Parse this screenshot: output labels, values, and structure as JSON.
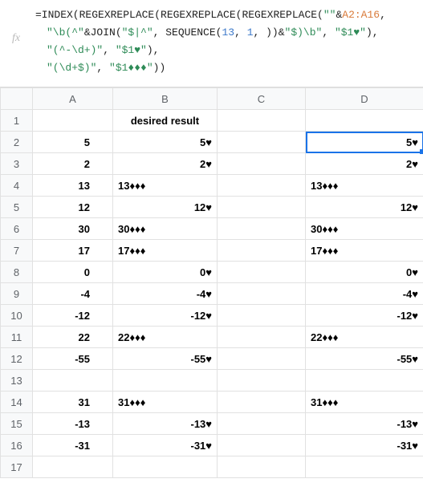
{
  "formula": {
    "parts_line1": [
      {
        "t": "=INDEX(REGEXREPLACE(REGEXREPLACE(REGEXREPLACE(",
        "c": "t-plain"
      },
      {
        "t": "\"\"",
        "c": "t-green"
      },
      {
        "t": "&",
        "c": "t-plain"
      },
      {
        "t": "A2:A16",
        "c": "t-orange"
      },
      {
        "t": ",",
        "c": "t-plain"
      }
    ],
    "parts_line2": [
      {
        "t": "\"\\b(^\"",
        "c": "t-green"
      },
      {
        "t": "&JOIN(",
        "c": "t-plain"
      },
      {
        "t": "\"$|^\"",
        "c": "t-green"
      },
      {
        "t": ", SEQUENCE(",
        "c": "t-plain"
      },
      {
        "t": "13",
        "c": "t-blue"
      },
      {
        "t": ", ",
        "c": "t-plain"
      },
      {
        "t": "1",
        "c": "t-blue"
      },
      {
        "t": ", ))&",
        "c": "t-plain"
      },
      {
        "t": "\"$)\\b\"",
        "c": "t-green"
      },
      {
        "t": ", ",
        "c": "t-plain"
      },
      {
        "t": "\"$1♥\"",
        "c": "t-green"
      },
      {
        "t": "),",
        "c": "t-plain"
      }
    ],
    "parts_line3": [
      {
        "t": "\"(^-\\d+)\"",
        "c": "t-green"
      },
      {
        "t": ", ",
        "c": "t-plain"
      },
      {
        "t": "\"$1♥\"",
        "c": "t-green"
      },
      {
        "t": "),",
        "c": "t-plain"
      }
    ],
    "parts_line4": [
      {
        "t": "\"(\\d+$)\"",
        "c": "t-green"
      },
      {
        "t": ", ",
        "c": "t-plain"
      },
      {
        "t": "\"$1♦♦♦\"",
        "c": "t-green"
      },
      {
        "t": "))",
        "c": "t-plain"
      }
    ]
  },
  "columns": {
    "a": "A",
    "b": "B",
    "c": "C",
    "d": "D"
  },
  "header_b": "desired result",
  "rows": [
    {
      "n": "1",
      "a": "",
      "b_hdr": true,
      "d": ""
    },
    {
      "n": "2",
      "a": "5",
      "b": "5♥",
      "balign": "r",
      "d": "5♥",
      "dalign": "r",
      "sel": true
    },
    {
      "n": "3",
      "a": "2",
      "b": "2♥",
      "balign": "r",
      "d": "2♥",
      "dalign": "r"
    },
    {
      "n": "4",
      "a": "13",
      "b": "13♦♦♦",
      "balign": "l",
      "d": "13♦♦♦",
      "dalign": "l"
    },
    {
      "n": "5",
      "a": "12",
      "b": "12♥",
      "balign": "r",
      "d": "12♥",
      "dalign": "r"
    },
    {
      "n": "6",
      "a": "30",
      "b": "30♦♦♦",
      "balign": "l",
      "d": "30♦♦♦",
      "dalign": "l"
    },
    {
      "n": "7",
      "a": "17",
      "b": "17♦♦♦",
      "balign": "l",
      "d": "17♦♦♦",
      "dalign": "l"
    },
    {
      "n": "8",
      "a": "0",
      "b": "0♥",
      "balign": "r",
      "d": "0♥",
      "dalign": "r"
    },
    {
      "n": "9",
      "a": "-4",
      "b": "-4♥",
      "balign": "r",
      "d": "-4♥",
      "dalign": "r"
    },
    {
      "n": "10",
      "a": "-12",
      "b": "-12♥",
      "balign": "r",
      "d": "-12♥",
      "dalign": "r"
    },
    {
      "n": "11",
      "a": "22",
      "b": "22♦♦♦",
      "balign": "l",
      "d": "22♦♦♦",
      "dalign": "l"
    },
    {
      "n": "12",
      "a": "-55",
      "b": "-55♥",
      "balign": "r",
      "d": "-55♥",
      "dalign": "r"
    },
    {
      "n": "13",
      "a": "",
      "b": "",
      "d": ""
    },
    {
      "n": "14",
      "a": "31",
      "b": "31♦♦♦",
      "balign": "l",
      "d": "31♦♦♦",
      "dalign": "l"
    },
    {
      "n": "15",
      "a": "-13",
      "b": "-13♥",
      "balign": "r",
      "d": "-13♥",
      "dalign": "r"
    },
    {
      "n": "16",
      "a": "-31",
      "b": "-31♥",
      "balign": "r",
      "d": "-31♥",
      "dalign": "r"
    },
    {
      "n": "17",
      "a": "",
      "b": "",
      "d": ""
    }
  ]
}
